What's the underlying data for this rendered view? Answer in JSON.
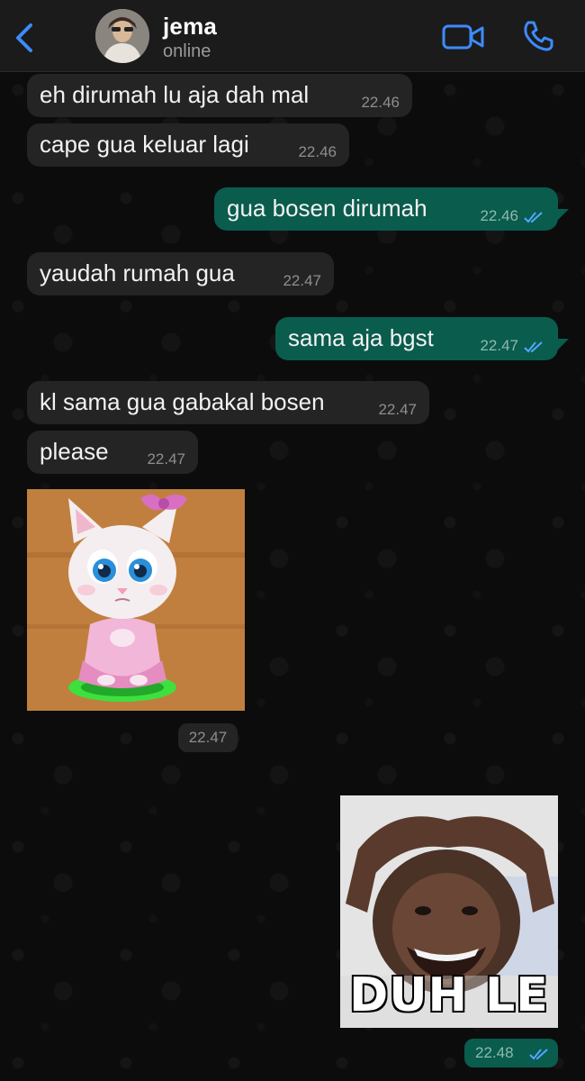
{
  "header": {
    "contact_name": "jema",
    "status": "online",
    "icons": [
      "chevron-left-icon",
      "video-icon",
      "phone-icon"
    ],
    "accent_color": "#3d8bfd"
  },
  "messages": [
    {
      "direction": "in",
      "text": "eh dirumah lu aja dah mal",
      "time": "22.46"
    },
    {
      "direction": "in",
      "text": "cape gua keluar lagi",
      "time": "22.46"
    },
    {
      "direction": "out",
      "text": "gua bosen dirumah",
      "time": "22.46",
      "read": true
    },
    {
      "direction": "in",
      "text": "yaudah rumah gua",
      "time": "22.47"
    },
    {
      "direction": "out",
      "text": "sama aja bgst",
      "time": "22.47",
      "read": true
    },
    {
      "direction": "in",
      "text": "kl sama gua gabakal bosen",
      "time": "22.47"
    },
    {
      "direction": "in",
      "text": "please",
      "time": "22.47"
    },
    {
      "direction": "in",
      "type": "sticker",
      "sticker": "cat-sticker",
      "time": "22.47"
    },
    {
      "direction": "out",
      "type": "sticker",
      "sticker": "duh-le-sticker",
      "caption": "DUH LE",
      "time": "22.48",
      "read": true
    }
  ],
  "colors": {
    "incoming_bubble": "#242424",
    "outgoing_bubble": "#0a5c4d",
    "read_tick": "#53a6ff"
  }
}
